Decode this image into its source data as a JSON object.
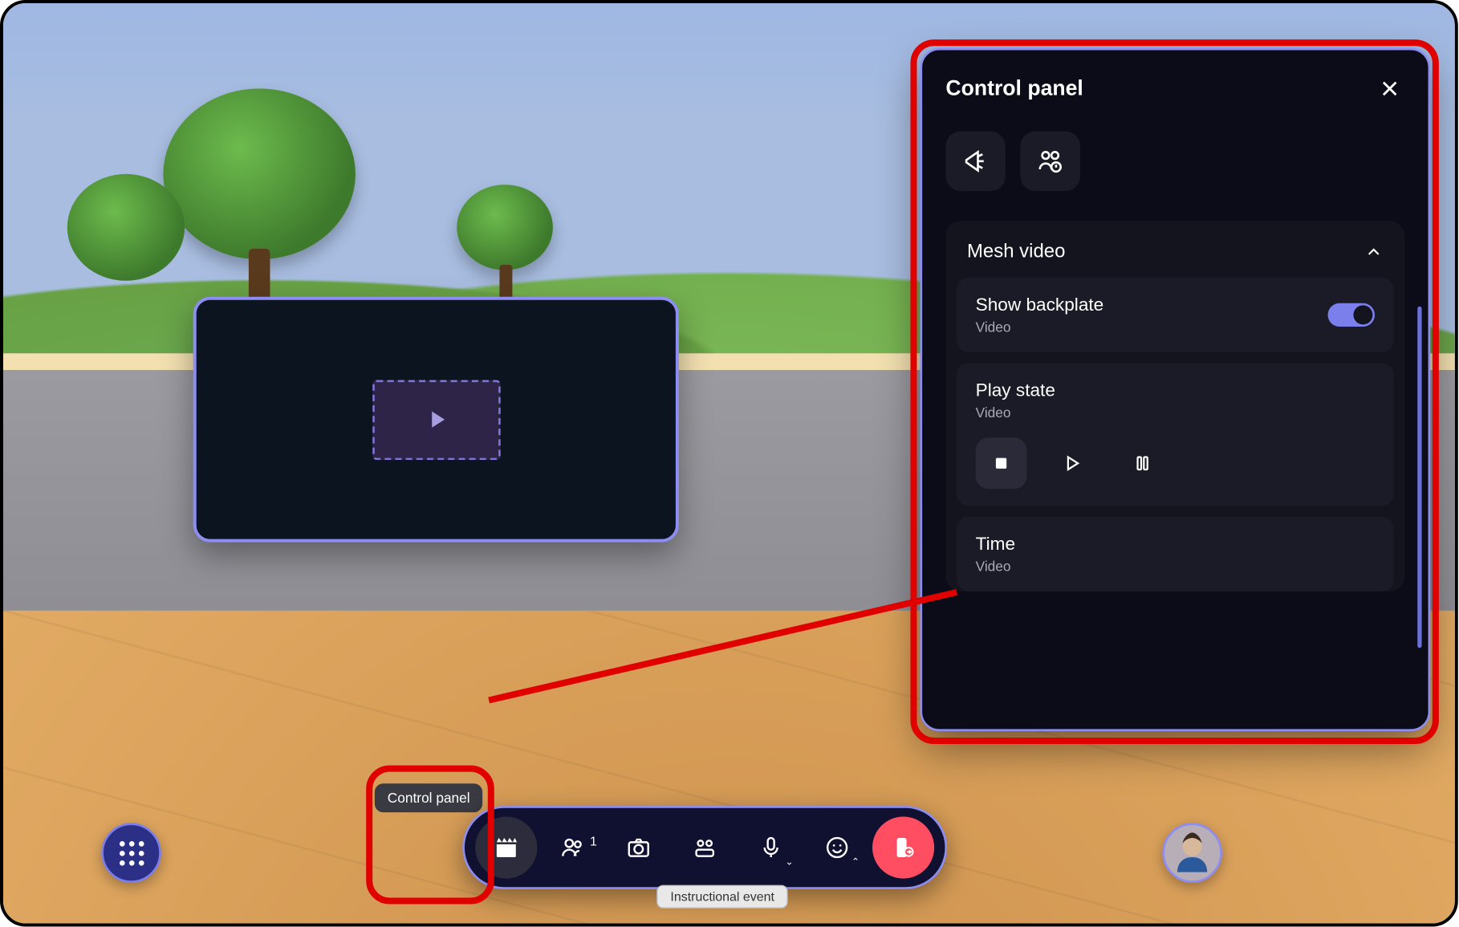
{
  "panel": {
    "title": "Control panel",
    "section": {
      "title": "Mesh video",
      "backplate": {
        "title": "Show backplate",
        "sub": "Video"
      },
      "playstate": {
        "title": "Play state",
        "sub": "Video"
      },
      "time": {
        "title": "Time",
        "sub": "Video"
      }
    }
  },
  "tooltip": "Control panel",
  "toolbar": {
    "participants_count": "1",
    "bottom_label": "Instructional event"
  }
}
